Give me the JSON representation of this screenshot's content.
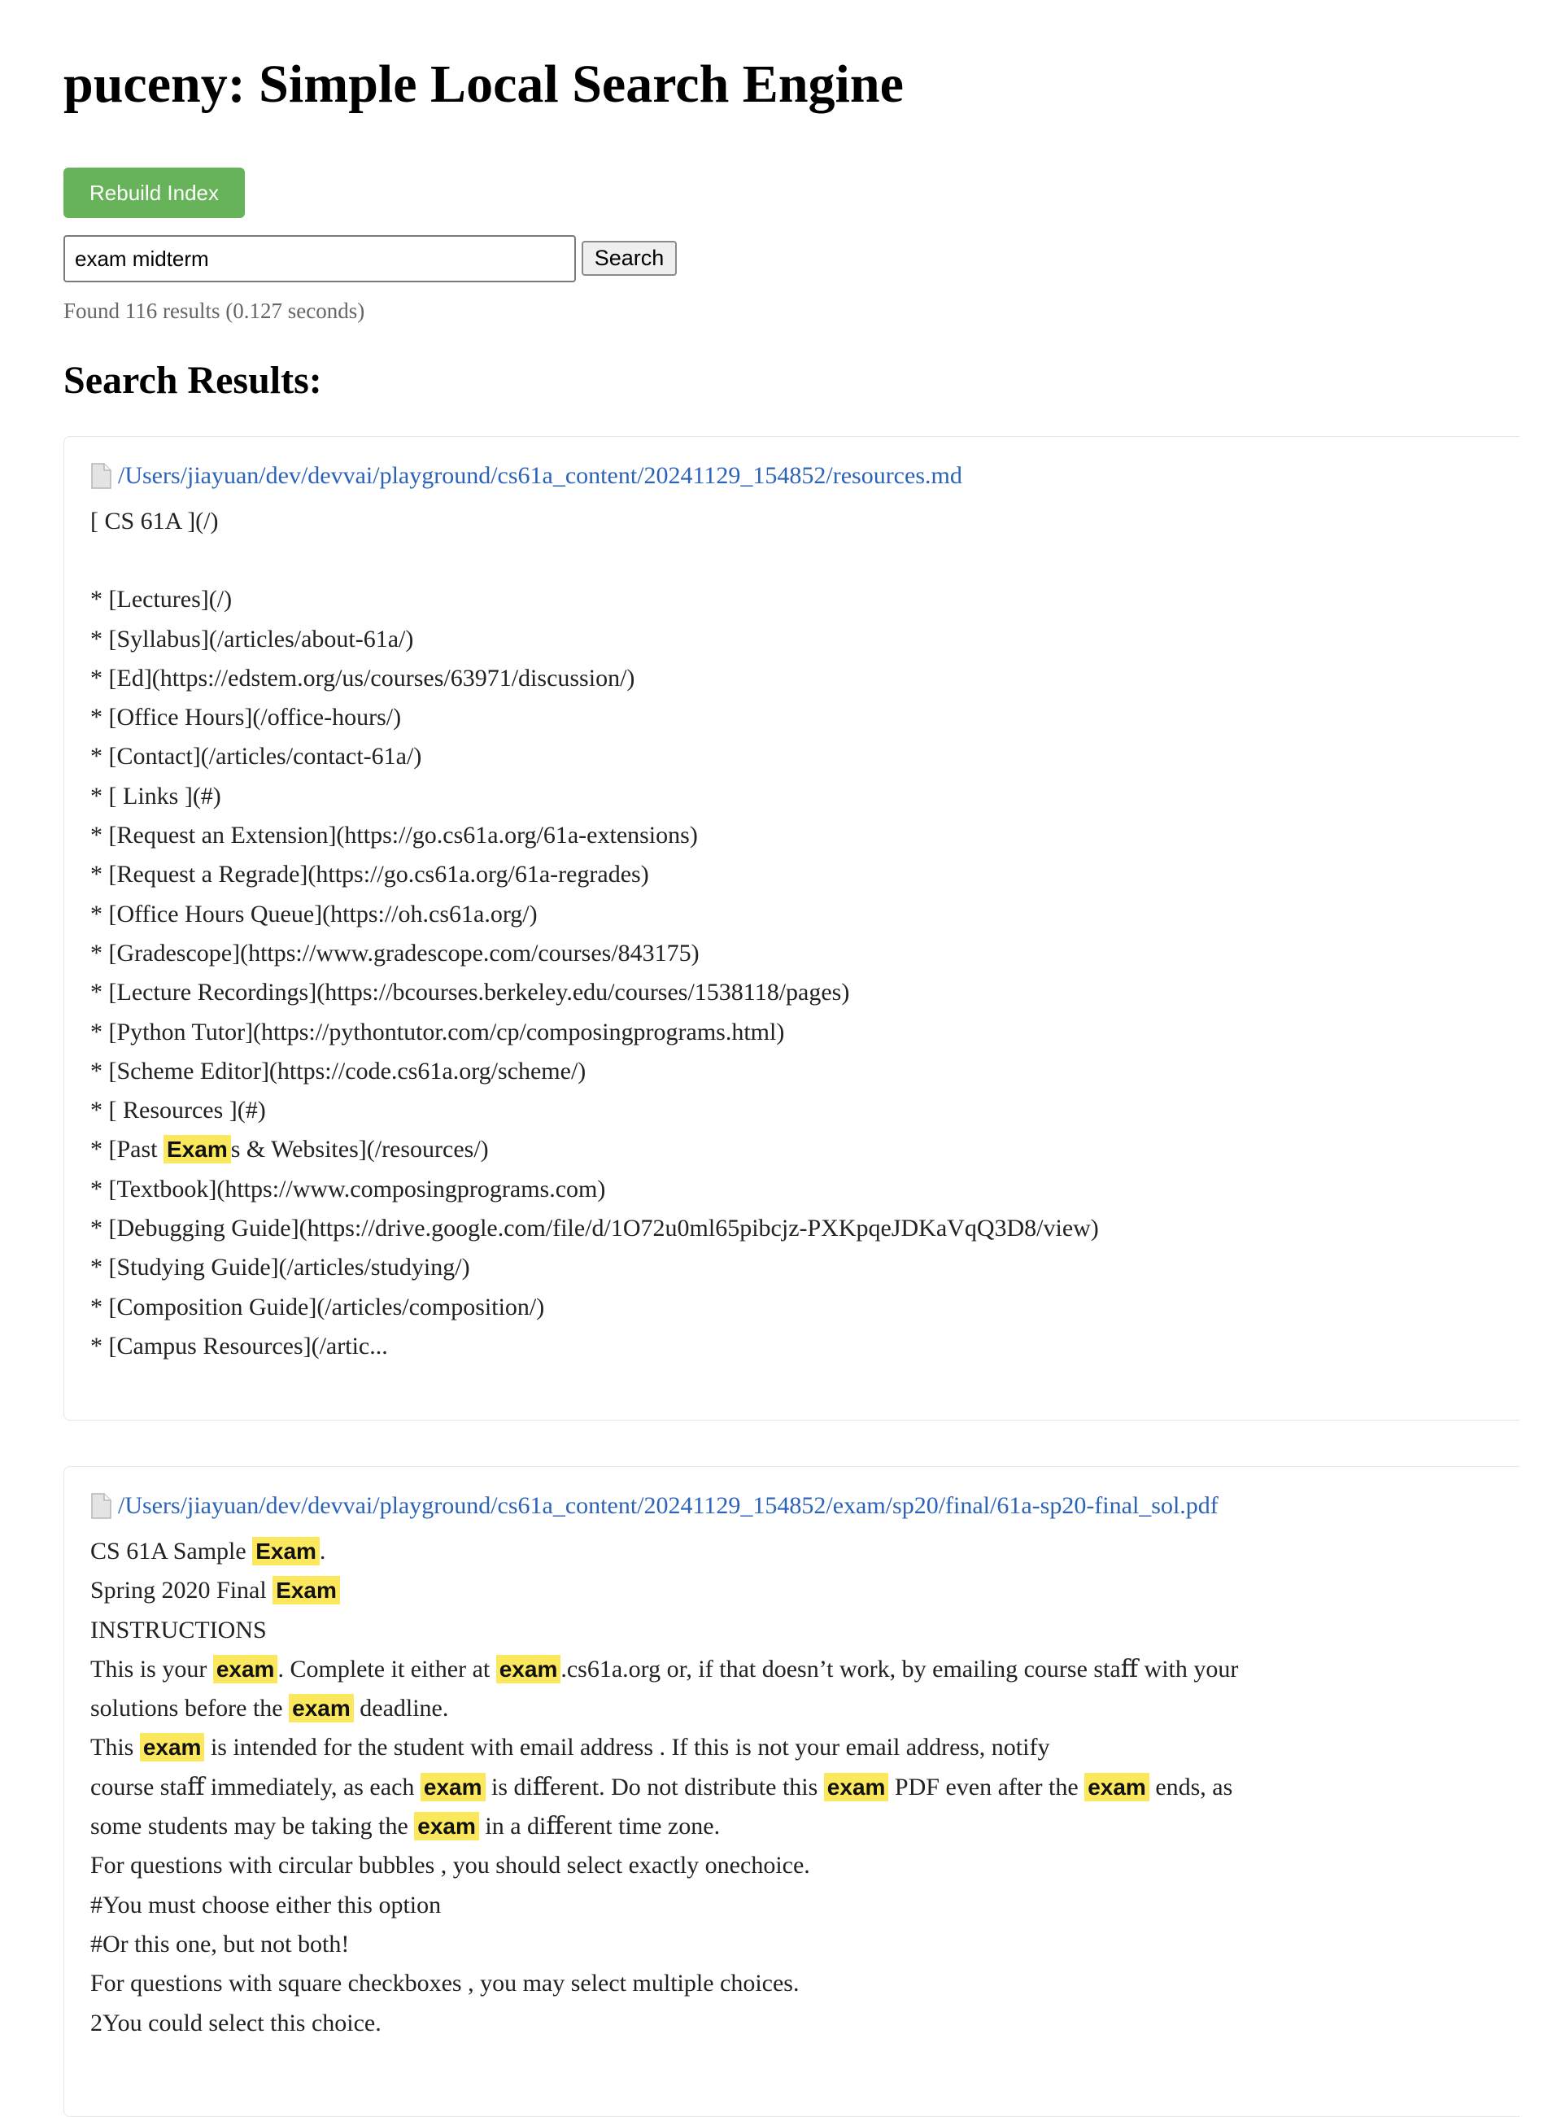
{
  "header": {
    "title": "puceny: Simple Local Search Engine"
  },
  "toolbar": {
    "rebuild_label": "Rebuild Index"
  },
  "search": {
    "value": "exam midterm",
    "button_label": "Search"
  },
  "stats": "Found 116 results (0.127 seconds)",
  "results_heading": "Search Results:",
  "colors": {
    "rebuild_button": "#67b35a",
    "link": "#2c63b8",
    "highlight": "#fbe85c"
  },
  "results": [
    {
      "icon": "file-icon",
      "path": "/Users/jiayuan/dev/devvai/playground/cs61a_content/20241129_154852/resources.md",
      "lines": [
        [
          {
            "t": "[ CS 61A ](/)"
          }
        ],
        [],
        [
          {
            "t": "* [Lectures](/)"
          }
        ],
        [
          {
            "t": "* [Syllabus](/articles/about-61a/)"
          }
        ],
        [
          {
            "t": "* [Ed](https://edstem.org/us/courses/63971/discussion/)"
          }
        ],
        [
          {
            "t": "* [Office Hours](/office-hours/)"
          }
        ],
        [
          {
            "t": "* [Contact](/articles/contact-61a/)"
          }
        ],
        [
          {
            "t": "* [ Links ](#)"
          }
        ],
        [
          {
            "t": "* [Request an Extension](https://go.cs61a.org/61a-extensions)"
          }
        ],
        [
          {
            "t": "* [Request a Regrade](https://go.cs61a.org/61a-regrades)"
          }
        ],
        [
          {
            "t": "* [Office Hours Queue](https://oh.cs61a.org/)"
          }
        ],
        [
          {
            "t": "* [Gradescope](https://www.gradescope.com/courses/843175)"
          }
        ],
        [
          {
            "t": "* [Lecture Recordings](https://bcourses.berkeley.edu/courses/1538118/pages)"
          }
        ],
        [
          {
            "t": "* [Python Tutor](https://pythontutor.com/cp/composingprograms.html)"
          }
        ],
        [
          {
            "t": "* [Scheme Editor](https://code.cs61a.org/scheme/)"
          }
        ],
        [
          {
            "t": "* [ Resources ](#)"
          }
        ],
        [
          {
            "t": "* [Past "
          },
          {
            "h": "Exam"
          },
          {
            "t": "s & Websites](/resources/)"
          }
        ],
        [
          {
            "t": "* [Textbook](https://www.composingprograms.com)"
          }
        ],
        [
          {
            "t": "* [Debugging Guide](https://drive.google.com/file/d/1O72u0ml65pibcjz-PXKpqeJDKaVqQ3D8/view)"
          }
        ],
        [
          {
            "t": "* [Studying Guide](/articles/studying/)"
          }
        ],
        [
          {
            "t": "* [Composition Guide](/articles/composition/)"
          }
        ],
        [
          {
            "t": "* [Campus Resources](/artic..."
          }
        ]
      ]
    },
    {
      "icon": "file-icon",
      "path": "/Users/jiayuan/dev/devvai/playground/cs61a_content/20241129_154852/exam/sp20/final/61a-sp20-final_sol.pdf",
      "lines": [
        [
          {
            "t": "CS 61A Sample "
          },
          {
            "h": "Exam"
          },
          {
            "t": "."
          }
        ],
        [
          {
            "t": "Spring 2020 Final "
          },
          {
            "h": "Exam"
          }
        ],
        [
          {
            "t": "INSTRUCTIONS"
          }
        ],
        [
          {
            "t": "This is your "
          },
          {
            "h": "exam"
          },
          {
            "t": ". Complete it either at "
          },
          {
            "h": "exam"
          },
          {
            "t": ".cs61a.org or, if that doesn’t work, by emailing course staﬀ with your"
          }
        ],
        [
          {
            "t": "solutions before the "
          },
          {
            "h": "exam"
          },
          {
            "t": " deadline."
          }
        ],
        [
          {
            "t": "This "
          },
          {
            "h": "exam"
          },
          {
            "t": " is intended for the student with email address . If this is not your email address, notify"
          }
        ],
        [
          {
            "t": "course staﬀ immediately, as each "
          },
          {
            "h": "exam"
          },
          {
            "t": " is diﬀerent. Do not distribute this "
          },
          {
            "h": "exam"
          },
          {
            "t": " PDF even after the "
          },
          {
            "h": "exam"
          },
          {
            "t": " ends, as"
          }
        ],
        [
          {
            "t": "some students may be taking the "
          },
          {
            "h": "exam"
          },
          {
            "t": " in a diﬀerent time zone."
          }
        ],
        [
          {
            "t": "For questions with circular bubbles , you should select exactly onechoice."
          }
        ],
        [
          {
            "t": "#You must choose either this option"
          }
        ],
        [
          {
            "t": "#Or this one, but not both!"
          }
        ],
        [
          {
            "t": "For questions with square checkboxes , you may select multiple choices."
          }
        ],
        [
          {
            "t": "2You could select this choice."
          }
        ]
      ]
    }
  ]
}
